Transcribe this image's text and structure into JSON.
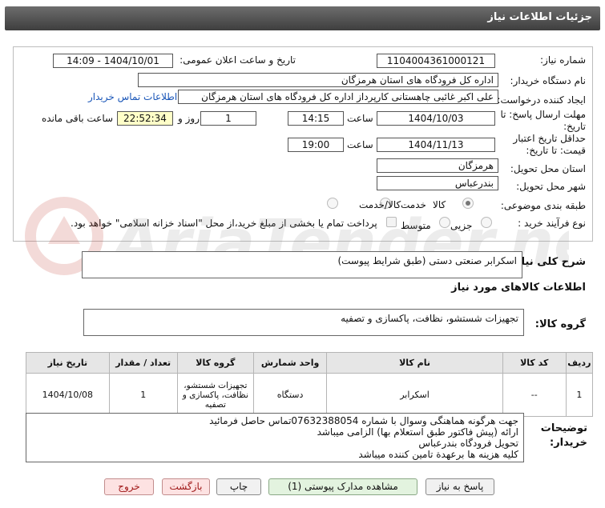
{
  "header": {
    "title": "جزئیات اطلاعات نیاز"
  },
  "form": {
    "need_number_label": "شماره نیاز:",
    "need_number": "1104004361000121",
    "announce_label": "تاریخ و ساعت اعلان عمومی:",
    "announce_value": "1404/10/01 - 14:09",
    "buyer_label": "نام دستگاه خریدار:",
    "buyer_value": "اداره کل فرودگاه های استان هرمزگان",
    "creator_label": "ایجاد کننده درخواست:",
    "creator_value": "علی اکبر غائبی چاهستانی کارپرداز اداره کل فرودگاه های استان هرمزگان",
    "contact_link": "اطلاعات تماس خریدار",
    "deadline_label": "مهلت ارسال پاسخ: تا تاریخ:",
    "deadline_date": "1404/10/03",
    "time_label": "ساعت",
    "deadline_time": "14:15",
    "days_value": "1",
    "days_label": "روز و",
    "remaining_time": "22:52:34",
    "remaining_label": "ساعت باقی مانده",
    "validity_label": "حداقل تاریخ اعتبار قیمت: تا تاریخ:",
    "validity_date": "1404/11/13",
    "validity_time": "19:00",
    "province_label": "استان محل تحویل:",
    "province_value": "هرمزگان",
    "city_label": "شهر محل تحویل:",
    "city_value": "بندرعباس",
    "category_label": "طبقه بندی موضوعی:",
    "category_options": [
      "کالا",
      "خدمت",
      "کالا/خدمت"
    ],
    "process_label": "نوع فرآیند خرید :",
    "process_options": [
      "جزیی",
      "متوسط"
    ],
    "payment_note": "پرداخت تمام یا بخشی از مبلغ خرید،از محل \"اسناد خزانه اسلامی\" خواهد بود."
  },
  "watermark": "AriaTender.neT",
  "description": {
    "label": "شرح کلی نیاز:",
    "value": "اسکرابر صنعتی دستی (طبق شرایط پیوست)"
  },
  "goods_info_title": "اطلاعات کالاهای مورد نیاز",
  "goods_group": {
    "label": "گروه کالا:",
    "value": "تجهیزات شستشو، نظافت، پاکسازی و تصفیه"
  },
  "table": {
    "headers": [
      "ردیف",
      "کد کالا",
      "نام کالا",
      "واحد شمارش",
      "گروه کالا",
      "تعداد / مقدار",
      "تاریخ نیاز"
    ],
    "rows": [
      [
        "1",
        "--",
        "اسکرابر",
        "دستگاه",
        "تجهیزات شستشو، نظافت، پاکسازی و تصفیه",
        "1",
        "1404/10/08"
      ]
    ]
  },
  "buyer_notes": {
    "label": "توضیحات خریدار:",
    "lines": [
      "جهت هرگونه هماهنگی وسوال با شماره 07632388054تماس حاصل فرمائید",
      "ارائه (پیش فاکتور طبق استعلام بها)  الزامی میباشد",
      "تحویل فرودگاه بندرعباس",
      "کلیه هزینه ها برعهدة تامین کننده میباشد"
    ]
  },
  "buttons": {
    "reply": "پاسخ به نیاز",
    "view_docs": "مشاهده مدارک پیوستی (1)",
    "print": "چاپ",
    "back": "بازگشت",
    "exit": "خروج"
  }
}
